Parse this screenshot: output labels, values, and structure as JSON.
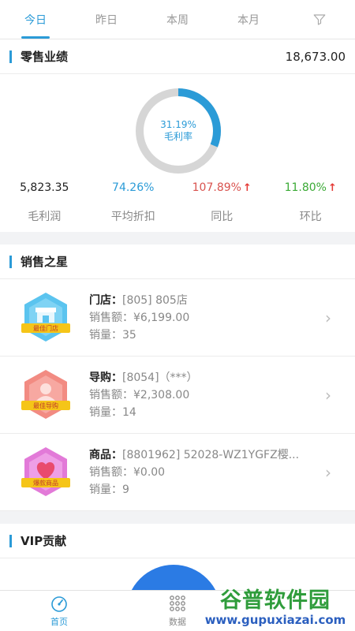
{
  "tabs": [
    {
      "label": "今日",
      "active": true
    },
    {
      "label": "昨日",
      "active": false
    },
    {
      "label": "本周",
      "active": false
    },
    {
      "label": "本月",
      "active": false
    }
  ],
  "retail": {
    "title": "零售业绩",
    "total": "18,673.00",
    "gross_margin_percent": "31.19%",
    "gross_margin_label": "毛利率",
    "gross_margin_fraction": 0.3119,
    "stats": [
      {
        "value": "5,823.35",
        "label": "毛利润",
        "color": "#222222",
        "arrow": false
      },
      {
        "value": "74.26%",
        "label": "平均折扣",
        "color": "#2b9bd7",
        "arrow": false
      },
      {
        "value": "107.89%",
        "label": "同比",
        "color": "#d9534f",
        "arrow": true
      },
      {
        "value": "11.80%",
        "label": "环比",
        "color": "#3aaa35",
        "arrow": true
      }
    ]
  },
  "star": {
    "title": "销售之星",
    "items": [
      {
        "badge": "最佳门店",
        "key": "门店：",
        "name": "[805] 805店",
        "amount": "销售额：¥6,199.00",
        "qty": "销量：35"
      },
      {
        "badge": "最佳导购",
        "key": "导购：",
        "name": "[8054]（***）",
        "amount": "销售额：¥2,308.00",
        "qty": "销量：14"
      },
      {
        "badge": "爆款商品",
        "key": "商品：",
        "name": "[8801962] 52028-WZ1YGFZ樱...",
        "amount": "销售额：¥0.00",
        "qty": "销量：9"
      }
    ]
  },
  "vip": {
    "title": "VIP贡献"
  },
  "nav": [
    {
      "label": "首页",
      "icon": "speedometer-icon",
      "active": true
    },
    {
      "label": "数据",
      "icon": "grid-dots-icon",
      "active": false
    }
  ],
  "watermark": {
    "main": "谷普软件园",
    "url": "www.gupuxiazai.com"
  },
  "colors": {
    "accent": "#2b9bd7",
    "up_red": "#e53935",
    "green": "#3aaa35"
  }
}
